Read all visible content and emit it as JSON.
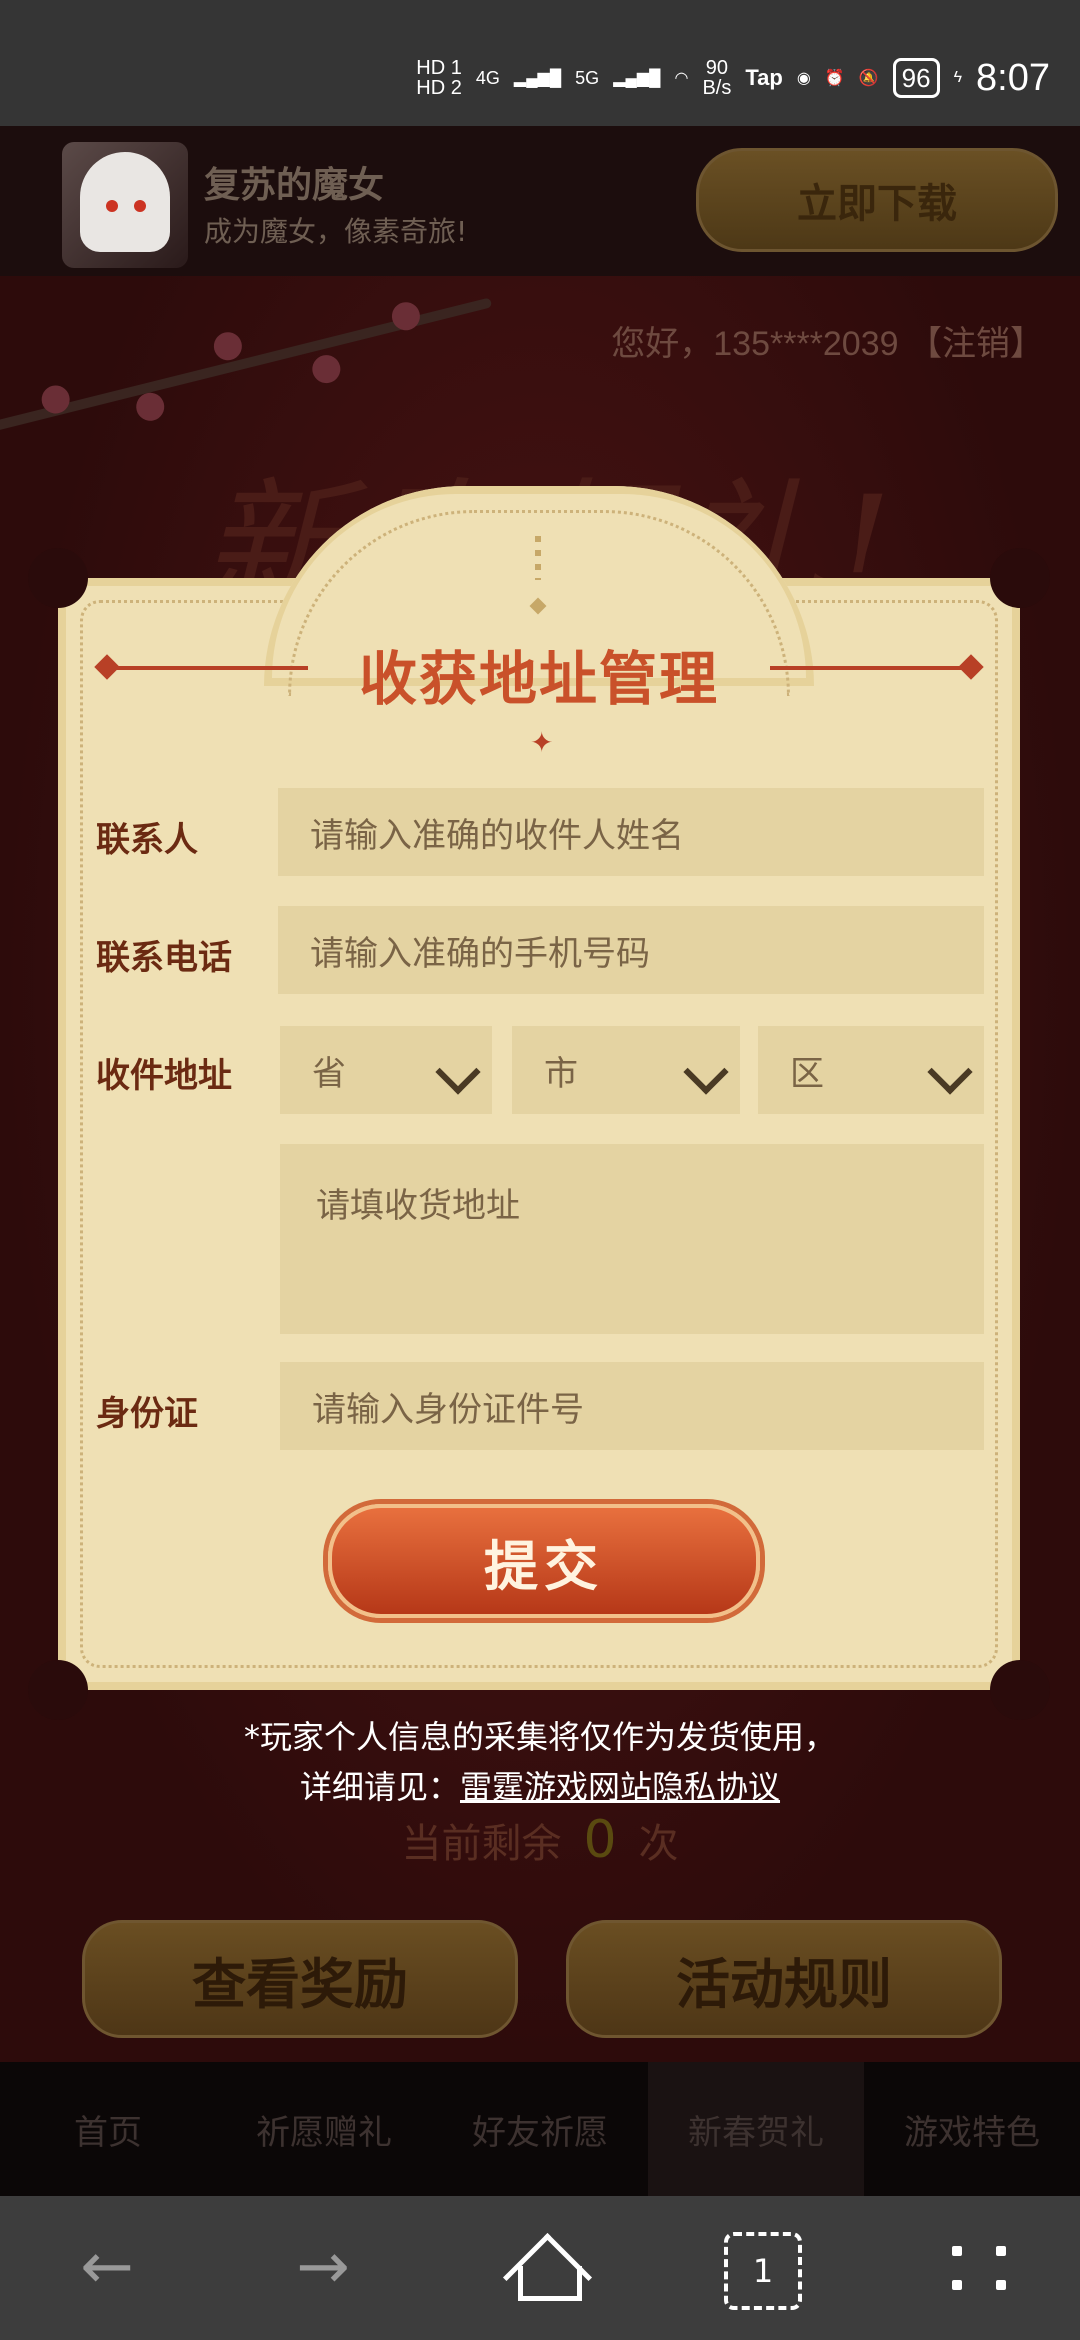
{
  "status_bar": {
    "hd1": "HD 1",
    "hd2": "HD 2",
    "net1": "4G",
    "net2": "5G",
    "speed_value": "90",
    "speed_unit": "B/s",
    "tap": "Tap",
    "battery": "96",
    "time": "8:07"
  },
  "app_banner": {
    "title": "复苏的魔女",
    "subtitle": "成为魔女，像素奇旅!",
    "download_label": "立即下载"
  },
  "page": {
    "greeting": "您好，135****2039 【注销】",
    "big_title": "新春贺礼!",
    "remain_prefix": "当前剩余",
    "remain_count": "0",
    "remain_suffix": "次",
    "view_rewards": "查看奖励",
    "rules": "活动规则"
  },
  "bottom_tabs": [
    "首页",
    "祈愿赠礼",
    "好友祈愿",
    "新春贺礼",
    "游戏特色"
  ],
  "modal": {
    "title": "收获地址管理",
    "contact_label": "联系人",
    "contact_placeholder": "请输入准确的收件人姓名",
    "phone_label": "联系电话",
    "phone_placeholder": "请输入准确的手机号码",
    "address_label": "收件地址",
    "province": "省",
    "city": "市",
    "district": "区",
    "address_placeholder": "请填收货地址",
    "id_label": "身份证",
    "id_placeholder": "请输入身份证件号",
    "submit": "提交"
  },
  "notice": {
    "line1": "*玩家个人信息的采集将仅作为发货使用，",
    "line2_prefix": "详细请见：",
    "link": "雷霆游戏网站隐私协议"
  },
  "system_nav": {
    "tab_count": "1"
  }
}
